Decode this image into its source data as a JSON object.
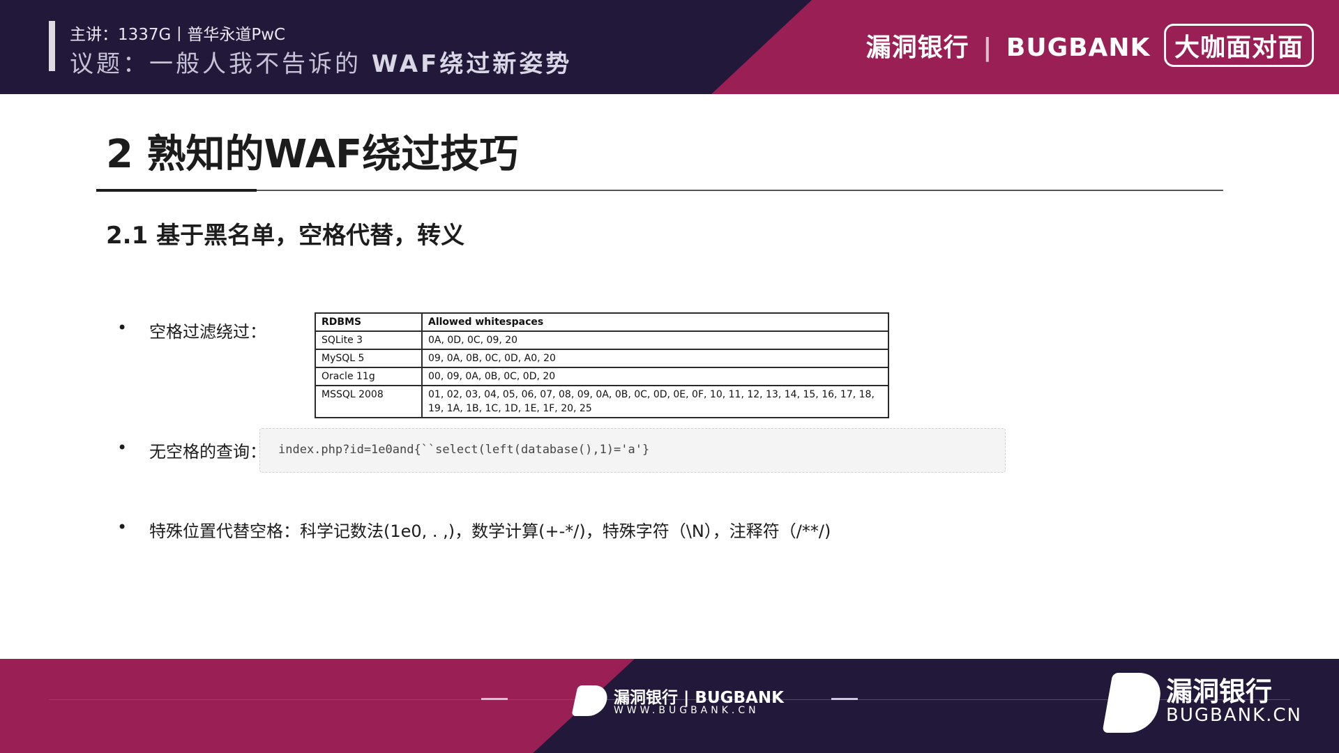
{
  "header": {
    "speaker": "主讲：1337G丨普华永道PwC",
    "topic_prefix": "议题：一般人我不告诉的",
    "topic_highlight": "WAF绕过新姿势",
    "brand": "漏洞银行",
    "brand_en": "BUGBANK",
    "badge": "大咖面对面"
  },
  "slide": {
    "title": "2 熟知的WAF绕过技巧",
    "subtitle": "2.1 基于黑名单，空格代替，转义"
  },
  "bullets": [
    {
      "label": "空格过滤绕过："
    },
    {
      "label": "无空格的查询："
    },
    {
      "label": "特殊位置代替空格：科学记数法(1e0, . ,)，数学计算(+-*/)，特殊字符（\\N），注释符（/**/)"
    }
  ],
  "table": {
    "headers": [
      "RDBMS",
      "Allowed whitespaces"
    ],
    "rows": [
      [
        "SQLite 3",
        "0A, 0D, 0C, 09, 20"
      ],
      [
        "MySQL 5",
        "09, 0A, 0B, 0C, 0D, A0, 20"
      ],
      [
        "Oracle 11g",
        "00, 09, 0A, 0B, 0C, 0D, 20"
      ],
      [
        "MSSQL 2008",
        "01, 02, 03, 04, 05, 06, 07, 08, 09, 0A, 0B, 0C, 0D, 0E, 0F, 10, 11, 12, 13, 14, 15, 16, 17, 18, 19, 1A, 1B, 1C, 1D, 1E, 1F, 20, 25"
      ]
    ]
  },
  "code": "index.php?id=1e0and{``select(left(database(),1)='a'}",
  "footer": {
    "brand": "漏洞银行 | BUGBANK",
    "url": "WWW.BUGBANK.CN",
    "brand_right": "漏洞银行",
    "url_right": "BUGBANK.CN"
  }
}
